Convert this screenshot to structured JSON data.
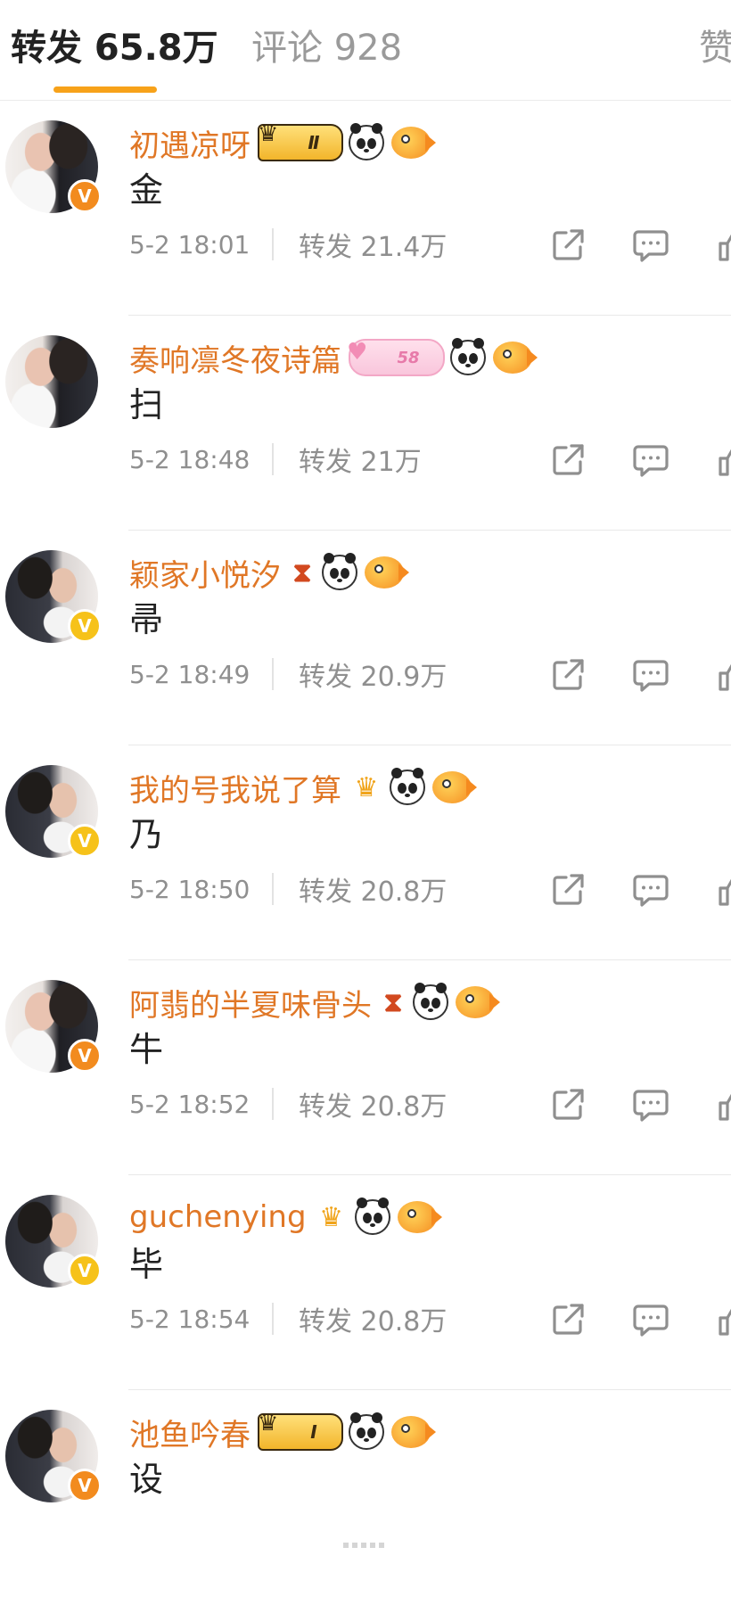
{
  "tabs": {
    "reposts": "转发 65.8万",
    "comments": "评论 928",
    "likes": "赞"
  },
  "colors": {
    "accent_underline": "#f7a21a",
    "username": "#e07726",
    "muted_text": "#8f8f8f"
  },
  "posts": [
    {
      "username": "初遇凉呀",
      "content": "金",
      "time": "5-2 18:01",
      "reposts": "转发 21.4万",
      "avatar": "wedding-photo",
      "verified": "orange",
      "badges": [
        "level-crown-II",
        "panda-icon",
        "fish-icon"
      ],
      "level_label": "Ⅱ"
    },
    {
      "username": "奏响凛冬夜诗篇",
      "content": "扫",
      "time": "5-2 18:48",
      "reposts": "转发 21万",
      "avatar": "wedding-photo",
      "verified": "none",
      "badges": [
        "pig-58",
        "panda-icon",
        "fish-icon"
      ],
      "level_label": "58"
    },
    {
      "username": "颖家小悦汐",
      "content": "帚",
      "time": "5-2 18:49",
      "reposts": "转发 20.9万",
      "avatar": "groom-photo",
      "verified": "yellow",
      "badges": [
        "hourglass-icon",
        "panda-icon",
        "fish-icon"
      ]
    },
    {
      "username": "我的号我说了算",
      "content": "乃",
      "time": "5-2 18:50",
      "reposts": "转发 20.8万",
      "avatar": "groom-photo",
      "verified": "yellow",
      "badges": [
        "gold-crown-icon",
        "panda-icon",
        "fish-icon"
      ]
    },
    {
      "username": "阿翡的半夏味骨头",
      "content": "牛",
      "time": "5-2 18:52",
      "reposts": "转发 20.8万",
      "avatar": "wedding-photo",
      "verified": "orange",
      "badges": [
        "hourglass-icon",
        "panda-icon",
        "fish-icon"
      ]
    },
    {
      "username": "guchenying",
      "content": "毕",
      "time": "5-2 18:54",
      "reposts": "转发 20.8万",
      "avatar": "groom-photo",
      "verified": "yellow",
      "badges": [
        "gold-crown-icon",
        "panda-icon",
        "fish-icon"
      ]
    },
    {
      "username": "池鱼吟春",
      "content": "设",
      "time": "",
      "reposts": "",
      "avatar": "groom-photo",
      "verified": "orange",
      "badges": [
        "level-crown-I",
        "panda-icon",
        "fish-icon"
      ],
      "level_label": "Ⅰ"
    }
  ],
  "verified_mark": "V"
}
